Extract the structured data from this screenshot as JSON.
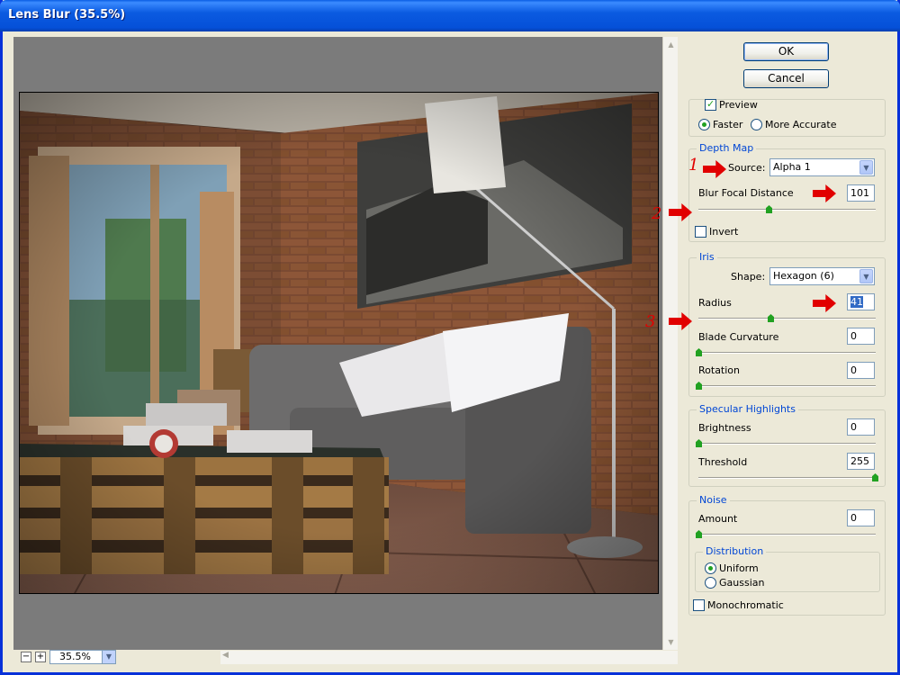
{
  "window": {
    "title": "Lens Blur (35.5%)"
  },
  "preview": {
    "zoom": "35.5%",
    "zoom_out": "−",
    "zoom_in": "+"
  },
  "buttons": {
    "ok": "OK",
    "cancel": "Cancel"
  },
  "preview_group": {
    "preview_label": "Preview",
    "preview_checked": true,
    "faster": "Faster",
    "more_accurate": "More Accurate",
    "selected": "Faster"
  },
  "depth_map": {
    "legend": "Depth Map",
    "source_label": "Source:",
    "source_value": "Alpha 1",
    "blur_focal_distance_label": "Blur Focal Distance",
    "blur_focal_distance_value": "101",
    "invert_label": "Invert"
  },
  "iris": {
    "legend": "Iris",
    "shape_label": "Shape:",
    "shape_value": "Hexagon (6)",
    "radius_label": "Radius",
    "radius_value": "41",
    "blade_curvature_label": "Blade Curvature",
    "blade_curvature_value": "0",
    "rotation_label": "Rotation",
    "rotation_value": "0"
  },
  "specular": {
    "legend": "Specular Highlights",
    "brightness_label": "Brightness",
    "brightness_value": "0",
    "threshold_label": "Threshold",
    "threshold_value": "255"
  },
  "noise": {
    "legend": "Noise",
    "amount_label": "Amount",
    "amount_value": "0",
    "distribution_legend": "Distribution",
    "uniform": "Uniform",
    "gaussian": "Gaussian",
    "selected": "Uniform",
    "monochromatic_label": "Monochromatic"
  },
  "annotations": {
    "n1": "1",
    "n2": "2",
    "n3": "3"
  },
  "colors": {
    "title_blue": "#0a5de3",
    "group_legend": "#0046d5",
    "annotation_red": "#e10000",
    "slider_green": "#21a121"
  }
}
